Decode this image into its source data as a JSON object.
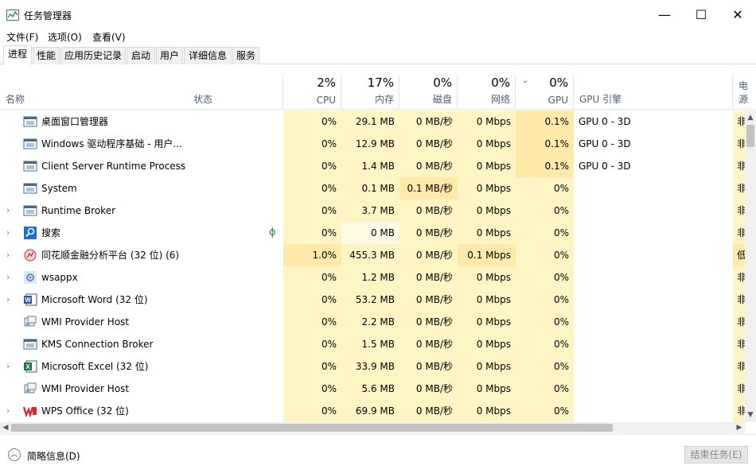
{
  "window": {
    "title": "任务管理器",
    "min": "—",
    "max": "☐",
    "close": "✕"
  },
  "menu": [
    "文件(F)",
    "选项(O)",
    "查看(V)"
  ],
  "tabs": [
    "进程",
    "性能",
    "应用历史记录",
    "启动",
    "用户",
    "详细信息",
    "服务"
  ],
  "columns": {
    "name": "名称",
    "status": "状态",
    "cpu": {
      "pct": "2%",
      "label": "CPU"
    },
    "memory": {
      "pct": "17%",
      "label": "内存"
    },
    "disk": {
      "pct": "0%",
      "label": "磁盘"
    },
    "network": {
      "pct": "0%",
      "label": "网络"
    },
    "gpu": {
      "pct": "0%",
      "label": "GPU"
    },
    "gpu_engine": "GPU 引擎",
    "power": "电源"
  },
  "rows": [
    {
      "name": "桌面窗口管理器",
      "cpu": "0%",
      "mem": "29.1 MB",
      "disk": "0 MB/秒",
      "net": "0 Mbps",
      "gpu": "0.1%",
      "engine": "GPU 0 - 3D",
      "power": "非",
      "icon": "window-icon"
    },
    {
      "name": "Windows 驱动程序基础 - 用户...",
      "cpu": "0%",
      "mem": "12.9 MB",
      "disk": "0 MB/秒",
      "net": "0 Mbps",
      "gpu": "0.1%",
      "engine": "GPU 0 - 3D",
      "power": "非",
      "icon": "window-icon"
    },
    {
      "name": "Client Server Runtime Process",
      "cpu": "0%",
      "mem": "1.4 MB",
      "disk": "0 MB/秒",
      "net": "0 Mbps",
      "gpu": "0.1%",
      "engine": "GPU 0 - 3D",
      "power": "非",
      "icon": "window-icon"
    },
    {
      "name": "System",
      "cpu": "0%",
      "mem": "0.1 MB",
      "disk": "0.1 MB/秒",
      "net": "0 Mbps",
      "gpu": "0%",
      "engine": "",
      "power": "非",
      "icon": "window-icon"
    },
    {
      "name": "Runtime Broker",
      "cpu": "0%",
      "mem": "3.7 MB",
      "disk": "0 MB/秒",
      "net": "0 Mbps",
      "gpu": "0%",
      "engine": "",
      "power": "非",
      "icon": "window-icon"
    },
    {
      "name": "搜索",
      "status": "ϕ",
      "cpu": "0%",
      "mem": "0 MB",
      "disk": "0 MB/秒",
      "net": "0 Mbps",
      "gpu": "0%",
      "engine": "",
      "power": "非",
      "icon": "search-icon"
    },
    {
      "name": "同花顺金融分析平台 (32 位) (6)",
      "cpu": "1.0%",
      "mem": "455.3 MB",
      "disk": "0 MB/秒",
      "net": "0.1 Mbps",
      "gpu": "0%",
      "engine": "",
      "power": "低",
      "icon": "stock-icon"
    },
    {
      "name": "wsappx",
      "cpu": "0%",
      "mem": "1.2 MB",
      "disk": "0 MB/秒",
      "net": "0 Mbps",
      "gpu": "0%",
      "engine": "",
      "power": "非",
      "icon": "gear-icon"
    },
    {
      "name": "Microsoft Word (32 位)",
      "cpu": "0%",
      "mem": "53.2 MB",
      "disk": "0 MB/秒",
      "net": "0 Mbps",
      "gpu": "0%",
      "engine": "",
      "power": "非",
      "icon": "word-icon"
    },
    {
      "name": "WMI Provider Host",
      "cpu": "0%",
      "mem": "2.2 MB",
      "disk": "0 MB/秒",
      "net": "0 Mbps",
      "gpu": "0%",
      "engine": "",
      "power": "非",
      "icon": "service-icon"
    },
    {
      "name": "KMS Connection Broker",
      "cpu": "0%",
      "mem": "1.5 MB",
      "disk": "0 MB/秒",
      "net": "0 Mbps",
      "gpu": "0%",
      "engine": "",
      "power": "非",
      "icon": "window-icon"
    },
    {
      "name": "Microsoft Excel (32 位)",
      "cpu": "0%",
      "mem": "33.9 MB",
      "disk": "0 MB/秒",
      "net": "0 Mbps",
      "gpu": "0%",
      "engine": "",
      "power": "非",
      "icon": "excel-icon"
    },
    {
      "name": "WMI Provider Host",
      "cpu": "0%",
      "mem": "5.6 MB",
      "disk": "0 MB/秒",
      "net": "0 Mbps",
      "gpu": "0%",
      "engine": "",
      "power": "非",
      "icon": "service-icon"
    },
    {
      "name": "WPS Office (32 位)",
      "cpu": "0%",
      "mem": "69.9 MB",
      "disk": "0 MB/秒",
      "net": "0 Mbps",
      "gpu": "0%",
      "engine": "",
      "power": "非",
      "icon": "wps-icon"
    }
  ],
  "footer": {
    "fewer_details": "简略信息(D)",
    "end_task": "结束任务(E)"
  }
}
